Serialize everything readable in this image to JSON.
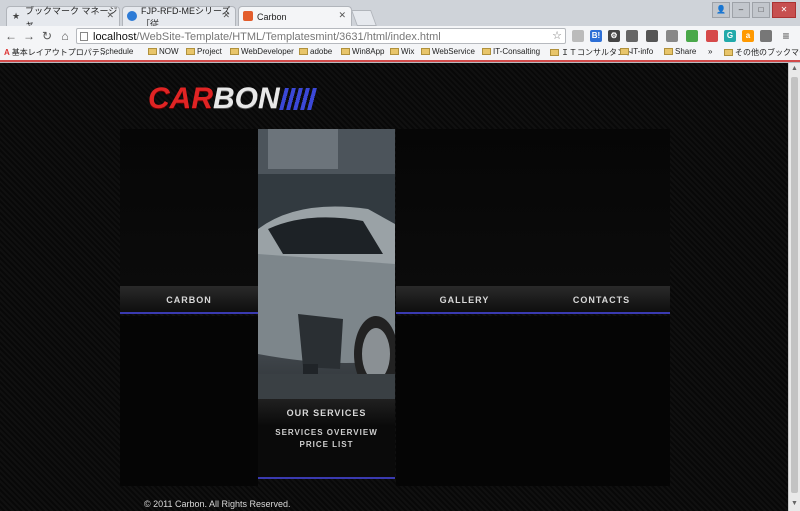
{
  "browser": {
    "tabs": [
      {
        "title": "ブックマーク マネージャ",
        "icon": "star-icon"
      },
      {
        "title": "FJP-RFD-MEシリーズ［従",
        "icon": "globe-icon"
      },
      {
        "title": "Carbon",
        "icon": "html5-icon"
      }
    ],
    "url_host": "localhost",
    "url_path": "/WebSite-Template/HTML/Templatesmint/3631/html/index.html",
    "bookmarks": [
      "基本レイアウトプロパテ…",
      "Schedule",
      "NOW",
      "Project",
      "WebDeveloper",
      "adobe",
      "Win8App",
      "Wix",
      "WebService",
      "IT-Consalting",
      "ＩＴコンサルタント",
      "IT-info",
      "Share",
      "»",
      "その他のブックマーク"
    ],
    "extensions": [
      "B!",
      "G"
    ]
  },
  "site": {
    "logo_part1": "CAR",
    "logo_part2": "BON",
    "nav": {
      "carbon": "CARBON",
      "gallery": "GALLERY",
      "contacts": "CONTACTS",
      "our_services": "OUR SERVICES"
    },
    "services": {
      "overview": "SERVICES OVERVIEW",
      "price_list": "PRICE LIST"
    },
    "footer": "© 2011 Carbon. All Rights Reserved."
  },
  "colors": {
    "accent_blue": "#3a3ab0",
    "logo_red": "#e02424"
  }
}
